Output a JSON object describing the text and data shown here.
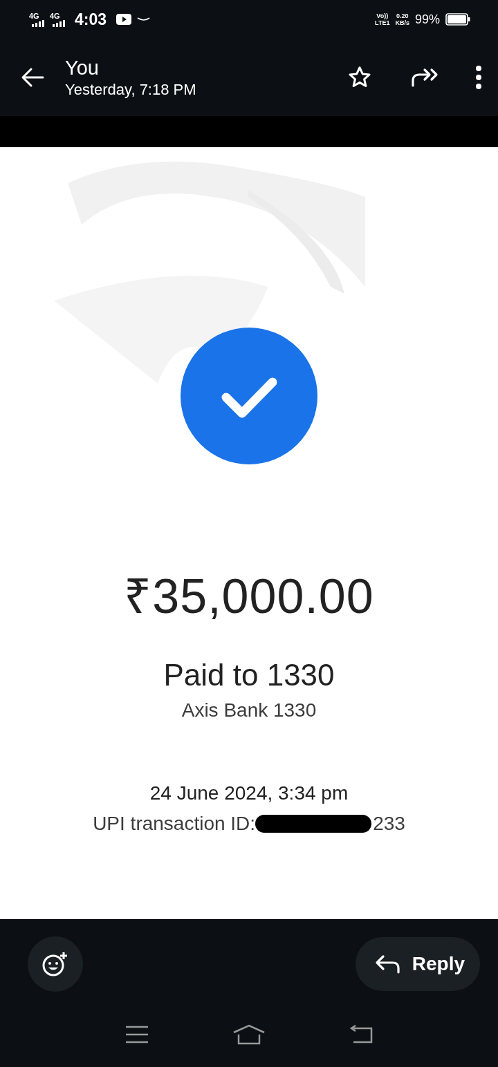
{
  "status_bar": {
    "networks": [
      "4G",
      "4G"
    ],
    "time": "4:03",
    "volte": [
      "Vo))",
      "LTE1"
    ],
    "speed": [
      "0.20",
      "KB/s"
    ],
    "battery": "99%"
  },
  "header": {
    "sender": "You",
    "timestamp": "Yesterday, 7:18 PM"
  },
  "receipt": {
    "amount": "₹35,000.00",
    "paid_to": "Paid to 1330",
    "bank": "Axis Bank 1330",
    "date": "24 June 2024, 3:34 pm",
    "transaction_label": "UPI transaction ID:",
    "transaction_tail": "233"
  },
  "actions": {
    "reply": "Reply"
  }
}
